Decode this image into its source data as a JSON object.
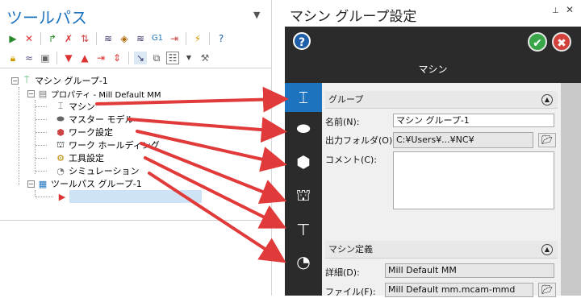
{
  "left_panel": {
    "title": "ツールパス",
    "tree": {
      "machine_group": "マシン グループ-1",
      "properties": "プロパティ - Mill Default MM",
      "machine": "マシン",
      "master_model": "マスター モデル",
      "stock_setup": "ワーク設定",
      "workholding": "ワーク ホールディング",
      "tool_settings": "工具設定",
      "simulation": "シミュレーション",
      "toolpath_group": "ツールパス グループ-1"
    },
    "toolbar_g1": "G1"
  },
  "right_panel": {
    "title": "マシン グループ設定",
    "header_title": "マシン",
    "group_section": {
      "title": "グループ",
      "name_label": "名前(N):",
      "name_value": "マシン グループ-1",
      "output_folder_label": "出力フォルダ(O):",
      "output_folder_value": "C:¥Users¥...¥NC¥",
      "comment_label": "コメント(C):",
      "comment_value": ""
    },
    "machine_section": {
      "title": "マシン定義",
      "detail_label": "詳細(D):",
      "detail_value": "Mill Default MM",
      "file_label": "ファイル(F):",
      "file_value": "Mill Default mm.mcam-mmd"
    }
  },
  "colors": {
    "title_blue": "#1e73be",
    "dark_bg": "#2b2b2b",
    "active_tab": "#1e73be",
    "arrow_red": "#e03a3a",
    "ok_green": "#3aa64a",
    "cancel_red": "#d2403a"
  }
}
